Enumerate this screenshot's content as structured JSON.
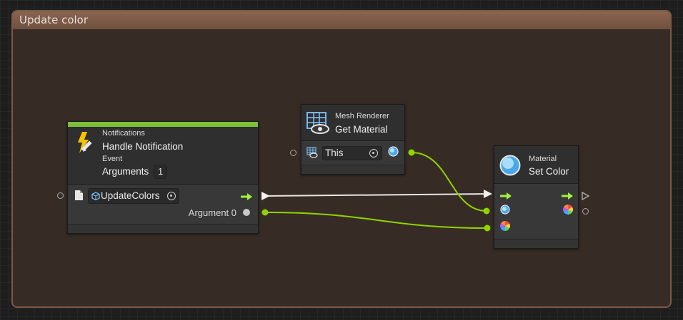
{
  "group": {
    "title": "Update color"
  },
  "colors": {
    "flow": "#8fd400",
    "control": "#e6e6e6",
    "accent_bar": "#7cc03a"
  },
  "nodes": {
    "notifications": {
      "category": "Notifications",
      "title": "Handle Notification",
      "subtitle": "Event",
      "arguments_label": "Arguments",
      "arguments_value": "1",
      "script_value": "UpdateColors",
      "output_label": "Argument 0",
      "icon": "lightning-pencil-icon"
    },
    "get_material": {
      "category": "Mesh Renderer",
      "title": "Get Material",
      "target_value": "This",
      "icon": "mesh-renderer-icon"
    },
    "set_color": {
      "category": "Material",
      "title": "Set Color",
      "icon": "material-sphere-icon"
    }
  }
}
